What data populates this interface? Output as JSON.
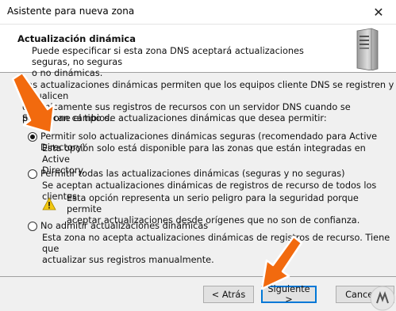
{
  "window": {
    "title": "Asistente para nueva zona",
    "close_glyph": "✕"
  },
  "header": {
    "title": "Actualización dinámica",
    "subtitle_line1": "Puede especificar si esta zona DNS aceptará actualizaciones seguras, no seguras",
    "subtitle_line2": "o no dinámicas.",
    "icon": "server-icon"
  },
  "intro": {
    "line1": "Las actualizaciones dinámicas permiten que los equipos cliente DNS se registren y actualicen",
    "line2": "dinámicamente sus registros de recursos con un servidor DNS cuando se produzcan cambios.",
    "prompt": "Seleccione el tipo de actualizaciones dinámicas que desea permitir:"
  },
  "options": [
    {
      "label": "Permitir solo actualizaciones dinámicas seguras (recomendado para Active Directory)",
      "desc_line1": "Esta opción solo está disponible para las zonas que están integradas en Active",
      "desc_line2": "Directory.",
      "checked": true
    },
    {
      "label": "Permitir todas las actualizaciones dinámicas (seguras y no seguras)",
      "desc_line1": "Se aceptan actualizaciones dinámicas de registros de recurso de todos los clientes.",
      "warning_line1": "Esta opción representa un serio peligro para la seguridad porque permite",
      "warning_line2": "aceptar actualizaciones desde orígenes que no son de confianza.",
      "checked": false
    },
    {
      "label": "No admitir actualizaciones dinámicas",
      "desc_line1": "Esta zona no acepta actualizaciones dinámicas de registros de recurso. Tiene que",
      "desc_line2": "actualizar sus registros manualmente.",
      "checked": false
    }
  ],
  "buttons": {
    "back": "< Atrás",
    "next": "Siguiente >",
    "cancel": "Cancelar"
  },
  "colors": {
    "accent": "#0078d7",
    "arrow": "#f26a0e",
    "warning": "#f2c811"
  }
}
